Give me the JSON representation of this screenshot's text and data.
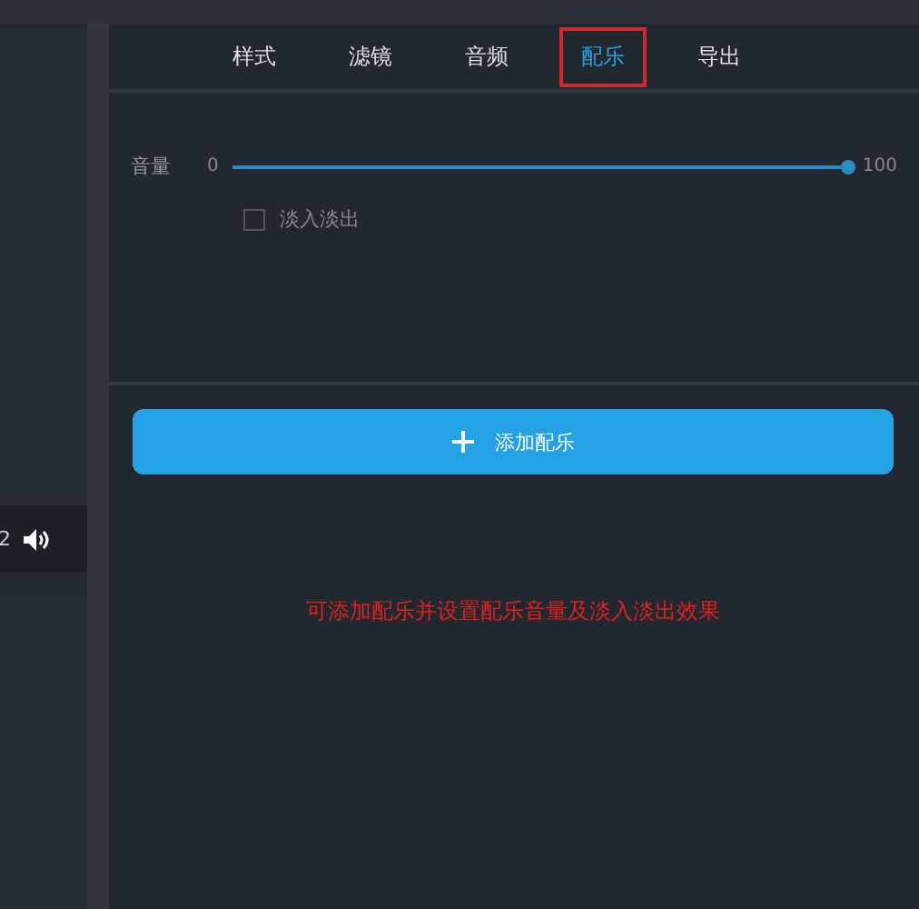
{
  "player": {
    "time_fragment": "2"
  },
  "tabs": [
    {
      "label": "样式",
      "selected": false
    },
    {
      "label": "滤镜",
      "selected": false
    },
    {
      "label": "音频",
      "selected": false
    },
    {
      "label": "配乐",
      "selected": true
    },
    {
      "label": "导出",
      "selected": false
    }
  ],
  "volume": {
    "label": "音量",
    "min": "0",
    "max": "100",
    "level": 1
  },
  "fade": {
    "label": "淡入淡出",
    "checked": false
  },
  "add_button": {
    "label": "添加配乐"
  },
  "note": "可添加配乐并设置配乐音量及淡入淡出效果"
}
